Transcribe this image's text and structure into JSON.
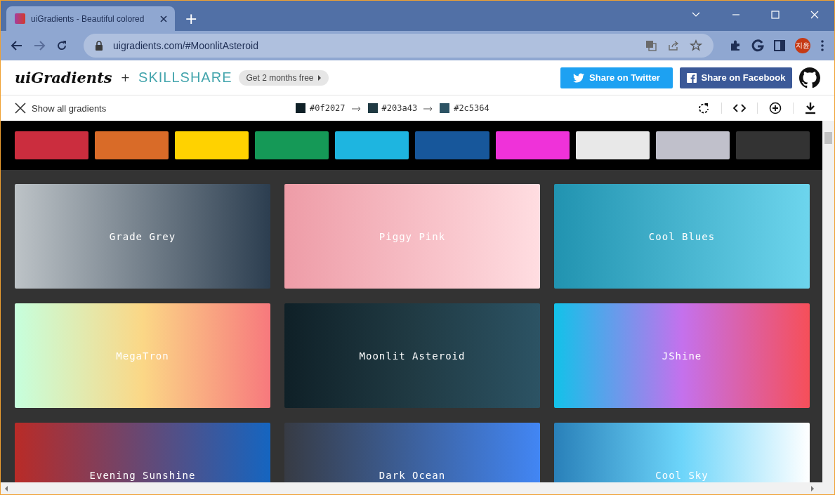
{
  "browser": {
    "tab_title": "uiGradients - Beautiful colored",
    "new_tab": "+",
    "url": "uigradients.com/#MoonlitAsteroid",
    "profile": "지윤"
  },
  "header": {
    "logo": "uiGradients",
    "plus": "+",
    "partner": "SKILLSHARE",
    "promo": "Get 2 months free",
    "twitter": "Share on Twitter",
    "facebook": "Share on Facebook"
  },
  "subbar": {
    "show_all": "Show all gradients",
    "stops": [
      {
        "hex": "#0f2027",
        "color": "#0f2027"
      },
      {
        "hex": "#203a43",
        "color": "#203a43"
      },
      {
        "hex": "#2c5364",
        "color": "#2c5364"
      }
    ]
  },
  "swatches": [
    {
      "color": "#cb2d3e"
    },
    {
      "color": "#d96b28"
    },
    {
      "color": "#ffd200"
    },
    {
      "color": "#159957"
    },
    {
      "color": "#1eb5e0"
    },
    {
      "color": "#17579b"
    },
    {
      "color": "#ef32d9"
    },
    {
      "color": "#e8e8e8"
    },
    {
      "color": "#c0c0cb"
    },
    {
      "color": "#333333"
    }
  ],
  "gradients": [
    {
      "name": "Grade Grey",
      "stops": [
        {
          "color": "#bdc3c7"
        },
        {
          "color": "#2c3e50"
        }
      ]
    },
    {
      "name": "Piggy Pink",
      "stops": [
        {
          "color": "#ee9ca7"
        },
        {
          "color": "#ffdde1"
        }
      ]
    },
    {
      "name": "Cool Blues",
      "stops": [
        {
          "color": "#2193b0"
        },
        {
          "color": "#6dd5ed"
        }
      ]
    },
    {
      "name": "MegaTron",
      "stops": [
        {
          "color": "#c6ffdd"
        },
        {
          "color": "#fbd786"
        },
        {
          "color": "#f7797d"
        }
      ]
    },
    {
      "name": "Moonlit Asteroid",
      "stops": [
        {
          "color": "#0f2027"
        },
        {
          "color": "#203a43"
        },
        {
          "color": "#2c5364"
        }
      ]
    },
    {
      "name": "JShine",
      "stops": [
        {
          "color": "#12c2e9"
        },
        {
          "color": "#c471ed"
        },
        {
          "color": "#f64f59"
        }
      ]
    },
    {
      "name": "Evening Sunshine",
      "stops": [
        {
          "color": "#b92b27"
        },
        {
          "color": "#1565c0"
        }
      ]
    },
    {
      "name": "Dark Ocean",
      "stops": [
        {
          "color": "#373b44"
        },
        {
          "color": "#4286f4"
        }
      ]
    },
    {
      "name": "Cool Sky",
      "stops": [
        {
          "color": "#2980b9"
        },
        {
          "color": "#6dd5fa"
        },
        {
          "color": "#ffffff"
        }
      ]
    }
  ]
}
